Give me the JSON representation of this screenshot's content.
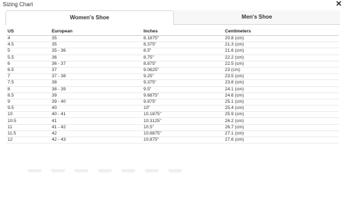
{
  "modal": {
    "title": "Sizing Chart",
    "close_symbol": "✕"
  },
  "tabs": [
    {
      "label": "Women's Shoe",
      "active": true
    },
    {
      "label": "Men's Shoe",
      "active": false
    }
  ],
  "table": {
    "headers": [
      "US",
      "European",
      "Inches",
      "Centimeters"
    ],
    "rows": [
      [
        "4",
        "35",
        "8.1875\"",
        "20.8 (cm)"
      ],
      [
        "4.5",
        "35",
        "8.375\"",
        "21.3 (cm)"
      ],
      [
        "5",
        "35 - 36",
        "8.5\"",
        "21.6 (cm)"
      ],
      [
        "5.5",
        "36",
        "8.75\"",
        "22.2 (cm)"
      ],
      [
        "6",
        "36 - 37",
        "8.875\"",
        "22.5 (cm)"
      ],
      [
        "6.5",
        "37",
        "9.0625\"",
        "23 (cm)"
      ],
      [
        "7",
        "37 - 38",
        "9.25\"",
        "23.5 (cm)"
      ],
      [
        "7.5",
        "38",
        "9.375\"",
        "23.8 (cm)"
      ],
      [
        "8",
        "38 - 39",
        "9.5\"",
        "24.1 (cm)"
      ],
      [
        "8.5",
        "39",
        "9.6875\"",
        "24.6 (cm)"
      ],
      [
        "9",
        "39 - 40",
        "9.875\"",
        "25.1 (cm)"
      ],
      [
        "9.5",
        "40",
        "10\"",
        "25.4 (cm)"
      ],
      [
        "10",
        "40 - 41",
        "10.1875\"",
        "25.9 (cm)"
      ],
      [
        "10.5",
        "41",
        "10.3125\"",
        "26.2 (cm)"
      ],
      [
        "11",
        "41 - 42",
        "10.5\"",
        "26.7 (cm)"
      ],
      [
        "11.5",
        "42",
        "10.6875\"",
        "27.1 (cm)"
      ],
      [
        "12",
        "42 - 43",
        "10.875\"",
        "27.6 (cm)"
      ]
    ]
  }
}
